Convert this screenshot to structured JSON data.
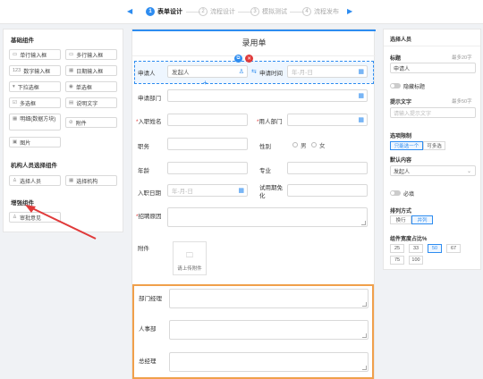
{
  "steps": [
    {
      "num": "1",
      "label": "表单设计"
    },
    {
      "num": "2",
      "label": "流程设计"
    },
    {
      "num": "3",
      "label": "模拟测试"
    },
    {
      "num": "4",
      "label": "流程发布"
    }
  ],
  "left": {
    "sections": {
      "basic": "基础组件",
      "org": "机构人员选择组件",
      "enhanced": "增强组件"
    },
    "basic_items": [
      {
        "icon": "▭",
        "label": "单行输入框"
      },
      {
        "icon": "▭",
        "label": "多行输入框"
      },
      {
        "icon": "123",
        "label": "数字输入框"
      },
      {
        "icon": "▦",
        "label": "日期输入框"
      },
      {
        "icon": "▾",
        "label": "下拉选框"
      },
      {
        "icon": "◉",
        "label": "单选框"
      },
      {
        "icon": "☑",
        "label": "多选框"
      },
      {
        "icon": "▤",
        "label": "说明文字"
      },
      {
        "icon": "▦",
        "label": "明细(数据方块)"
      },
      {
        "icon": "⊘",
        "label": "附件"
      },
      {
        "icon": "▣",
        "label": "图片"
      }
    ],
    "org_items": [
      {
        "icon": "♙",
        "label": "选择人员"
      },
      {
        "icon": "▦",
        "label": "选择机构"
      }
    ],
    "enhanced_items": [
      {
        "icon": "♙",
        "label": "审批意见"
      }
    ]
  },
  "form": {
    "title": "录用单",
    "applicant_label": "申请人",
    "applicant_value": "发起人",
    "apply_time_label": "申请时间",
    "date_placeholder": "年-月-日",
    "dept_label": "申请部门",
    "hire_name_label": "入职姓名",
    "hiring_person_label": "用人部门",
    "position_label": "职务",
    "gender_label": "性别",
    "gender_male": "男",
    "gender_female": "女",
    "age_label": "年龄",
    "major_label": "专业",
    "hire_date_label": "入职日期",
    "probation_label": "试用期免化",
    "reason_label": "招聘原因",
    "attachment_label": "附件",
    "upload_label": "请上传附件",
    "dept_manager_label": "部门经理",
    "hr_label": "人事部",
    "gm_label": "总经理",
    "required_mark": "*"
  },
  "right": {
    "header": "选择人员",
    "title_label": "标题",
    "title_max": "最多20字",
    "title_value": "申请人",
    "hide_label": "隐藏标题",
    "hint_label": "提示文字",
    "hint_max": "最多50字",
    "hint_placeholder": "请输入提示文字",
    "select_limit_label": "选项限制",
    "limit_options": [
      "只能选一个",
      "可多选"
    ],
    "default_label": "默认内容",
    "default_value": "发起人",
    "required_label": "必填",
    "layout_label": "排列方式",
    "layout_options": [
      "换行",
      "并列"
    ],
    "width_label": "组件宽度占比%",
    "width_options": [
      "25",
      "33",
      "50",
      "67",
      "75",
      "100"
    ]
  },
  "colors": {
    "accent": "#2d8cf0",
    "highlight_border": "#f0a04b",
    "annotation_arrow": "#e03a3a"
  }
}
